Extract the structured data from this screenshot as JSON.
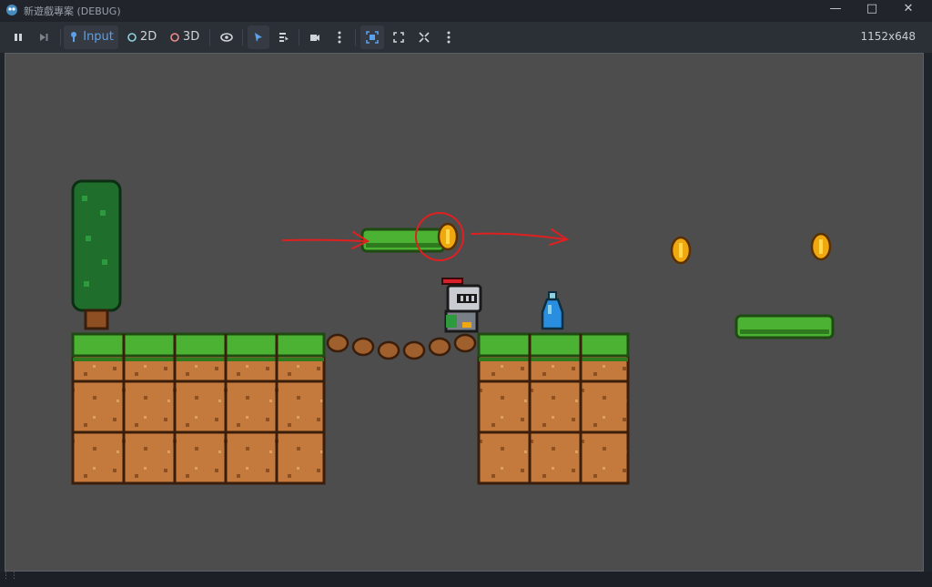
{
  "window": {
    "title": "新遊戲專案 (DEBUG)",
    "icons": {
      "app": "godot-icon",
      "minimize": "minimize-icon",
      "maximize": "maximize-icon",
      "close": "close-icon"
    }
  },
  "toolbar": {
    "input_label": "Input",
    "label_2d": "2D",
    "label_3d": "3D",
    "resolution": "1152x648"
  },
  "colors": {
    "accent": "#4e8ce0",
    "annotation": "#e02020"
  }
}
